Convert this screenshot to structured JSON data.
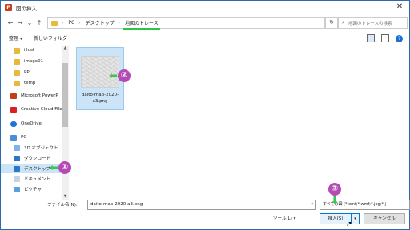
{
  "window": {
    "title": "図の挿入",
    "app_icon_letter": "P"
  },
  "nav": {
    "back": "←",
    "forward": "→",
    "up_recent": "⌄",
    "up": "↑",
    "breadcrumb": [
      "PC",
      "デスクトップ",
      "地図のトレース"
    ],
    "separator": "›",
    "search_placeholder": "地図のトレースの検索"
  },
  "toolbar": {
    "organize": "整理 ▾",
    "new_folder": "新しいフォルダー"
  },
  "sidebar": {
    "items": [
      {
        "label": "illust",
        "icon": "folder-icon"
      },
      {
        "label": "image01",
        "icon": "folder-icon"
      },
      {
        "label": "PP",
        "icon": "folder-icon"
      },
      {
        "label": "temp",
        "icon": "folder-icon"
      },
      {
        "label": "Microsoft PowerP",
        "icon": "powerpoint-icon"
      },
      {
        "label": "Creative Cloud File",
        "icon": "creative-cloud-icon"
      },
      {
        "label": "OneDrive",
        "icon": "onedrive-icon"
      },
      {
        "label": "PC",
        "icon": "pc-icon"
      },
      {
        "label": "3D オブジェクト",
        "icon": "3d-objects-icon"
      },
      {
        "label": "ダウンロード",
        "icon": "download-icon"
      },
      {
        "label": "デスクトップ",
        "icon": "desktop-icon",
        "selected": true
      },
      {
        "label": "ドキュメント",
        "icon": "documents-icon"
      },
      {
        "label": "ピクチャ",
        "icon": "pictures-icon"
      }
    ]
  },
  "files": [
    {
      "name": "daito-map-2020-a3.png"
    }
  ],
  "footer": {
    "filename_label": "ファイル名(N):",
    "filename_value": "daito-map-2020-a3.png",
    "filetype_value": "すべての図 (*.emf;*.wmf;*.jpg;*.j",
    "tools_label": "ツール(L) ▾",
    "insert_label": "挿入(S)",
    "cancel_label": "キャンセル"
  },
  "callouts": [
    "①",
    "②",
    "③"
  ],
  "colors": {
    "accent_green": "#3bc453",
    "callout_purple": "#b44ab5",
    "selection": "#cce4f7"
  }
}
